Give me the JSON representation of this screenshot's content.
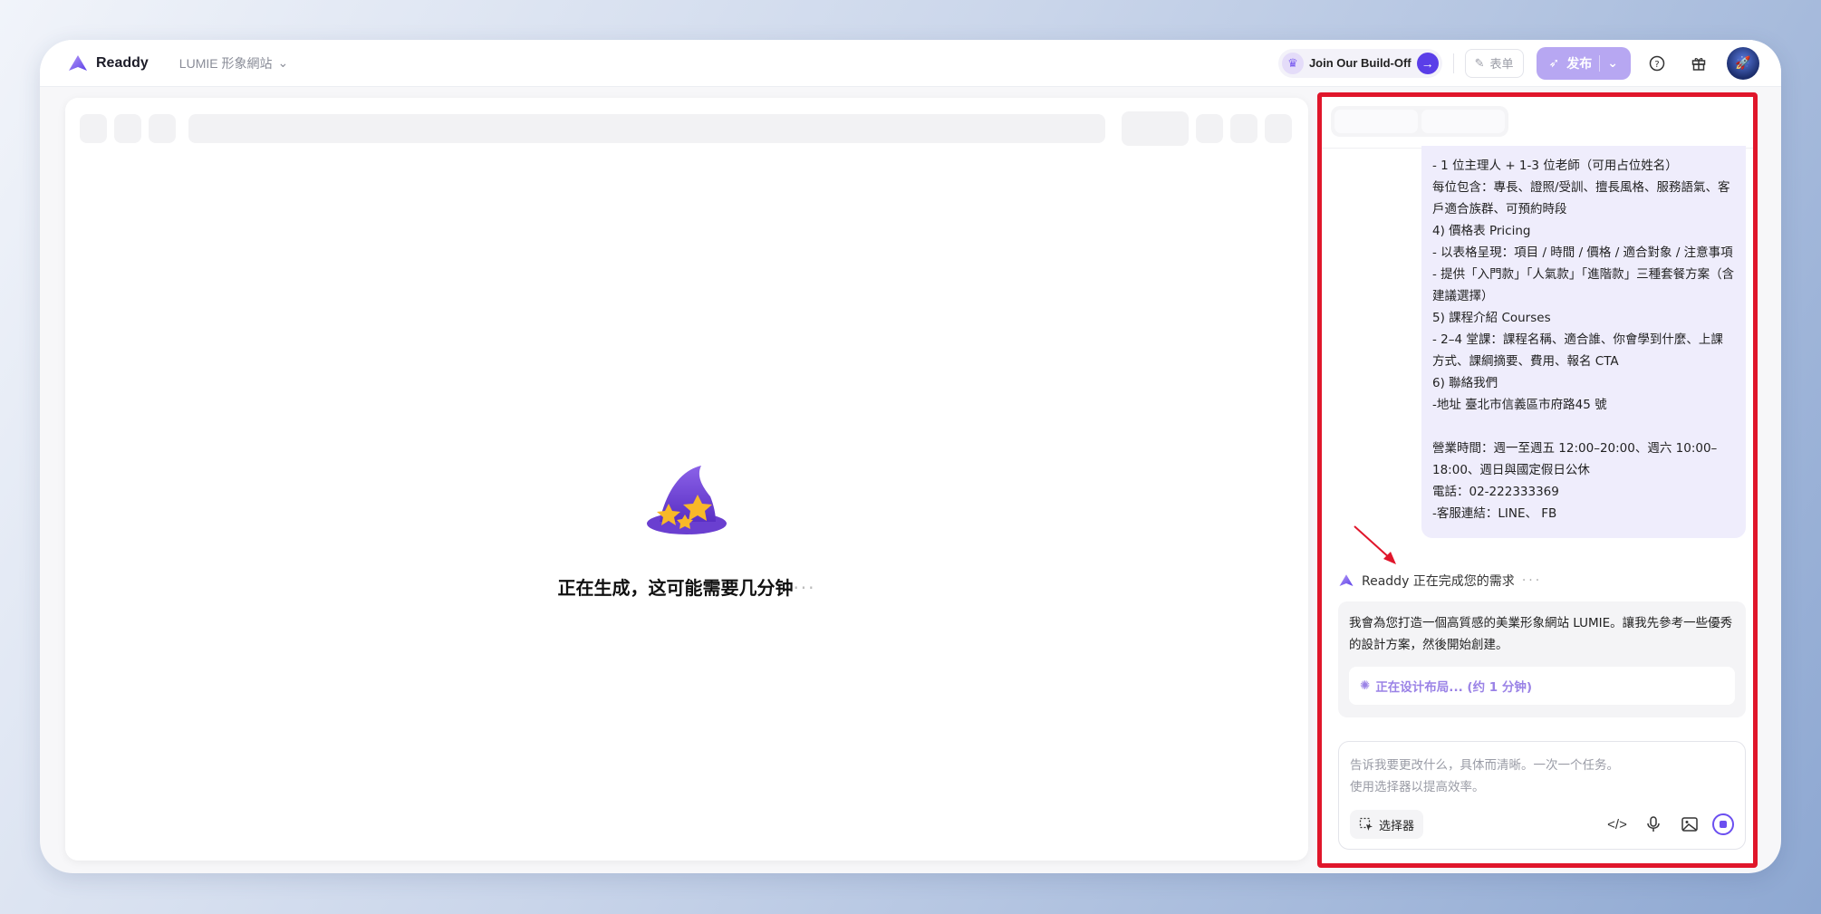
{
  "app": {
    "name": "Readdy"
  },
  "header": {
    "project_name": "LUMIE 形象網站",
    "buildoff_label": "Join Our Build-Off",
    "form_label": "表单",
    "publish_label": "发布"
  },
  "preview": {
    "generating_text": "正在生成，这可能需要几分钟",
    "dots": "···"
  },
  "chat": {
    "user_message": "- 1 位主理人 + 1-3 位老師（可用占位姓名）\n每位包含：專長、證照/受訓、擅長風格、服務語氣、客戶適合族群、可預約時段\n4) 價格表 Pricing\n- 以表格呈現：項目 / 時間 / 價格 / 適合對象 / 注意事項\n- 提供「入門款」「人氣款」「進階款」三種套餐方案（含建議選擇）\n5) 課程介紹 Courses\n- 2–4 堂課：課程名稱、適合誰、你會學到什麼、上課方式、課綱摘要、費用、報名 CTA\n6) 聯絡我們\n-地址 臺北市信義區市府路45 號\n\n營業時間：週一至週五 12:00–20:00、週六 10:00–18:00、週日與國定假日公休\n電話：02-222333369\n-客服連結：LINE、 FB",
    "status_text": "Readdy 正在完成您的需求",
    "status_dots": "···",
    "ai_message": "我會為您打造一個高質感的美業形象網站 LUMIE。讓我先參考一些優秀的設計方案，然後開始創建。",
    "task_label": "正在设计布局... (约 1 分钟)",
    "composer_placeholder_1": "告诉我要更改什么，具体而清晰。一次一个任务。",
    "composer_placeholder_2": "使用选择器以提高效率。",
    "selector_label": "选择器"
  },
  "colors": {
    "accent": "#6b4ff0",
    "highlight_border": "#e0162b",
    "user_bubble": "#efedfc",
    "publish_bg": "#b7a7f2"
  }
}
